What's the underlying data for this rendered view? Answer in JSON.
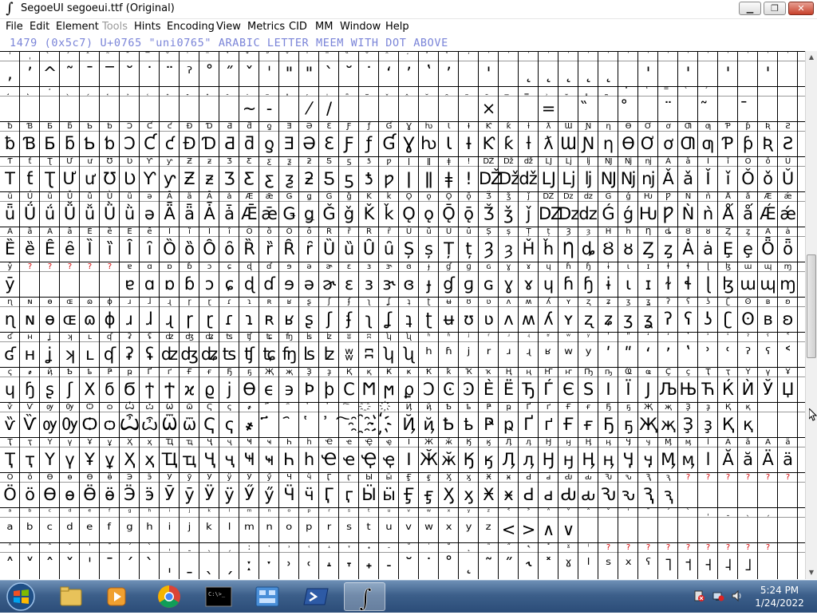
{
  "window": {
    "title": "SegoeUI  segoeui.ttf (Original)",
    "app_icon_glyph": "∫",
    "minimize_glyph": "▁",
    "maximize_glyph": "❐",
    "close_glyph": "✕"
  },
  "menu": [
    {
      "label": "File",
      "disabled": false
    },
    {
      "label": "Edit",
      "disabled": false
    },
    {
      "label": "Element",
      "disabled": false
    },
    {
      "label": "Tools",
      "disabled": true
    },
    {
      "label": "Hints",
      "disabled": false
    },
    {
      "label": "Encoding",
      "disabled": false
    },
    {
      "label": "View",
      "disabled": false
    },
    {
      "label": "Metrics",
      "disabled": false
    },
    {
      "label": "CID",
      "disabled": false
    },
    {
      "label": "MM",
      "disabled": false
    },
    {
      "label": "Window",
      "disabled": false
    },
    {
      "label": "Help",
      "disabled": false
    }
  ],
  "info_line": "1479 (0x5c7) U+0765 \"uni0765\" ARABIC LETTER MEEM WITH DOT ABOVE",
  "grid_rows": [
    {
      "labels": "ˈˌ̀́̂̃̄̅̆̇̈̉̊̋̌̍̎̏̐̑̒̓̔̕̚̚̚̚̚̚̚̚̚̚̚̚̚̚̚̚̚̚̚̚",
      "glyphs": ",ʼ^˜¯‾˘˙¨ˀ˚˝ˇˈ\"\"ˋ˘˙ʻʼʽʼ ' ˛˛˛˛˛ ' ' ' ' ' ' ' ' ' ' ' ' "
    },
    {
      "labels": "̧̨̛̖̗̘̙̜̝̞̟̠̣̤̥̦̩̪̫̬̭̮̯̰̱̲̳̹̺̻̼̽̾̿̀́",
      "glyphs": "            ~‐ ⁄/       ×  = ̏ ̊ ¨ ̃ ̄     ≈ ̃ "
    },
    {
      "labels": "ƀƁƂƃƄƅƆƇƈƉƊƋƌƍƎƏƐƑƒƓƔƕƖƗƘƙƚƛƜƝƞƟƠơƢƣƤƥƦƧƨƩƪƫ",
      "glyphs": "ƀƁƂƃƄƅƆƇƈƉƊƋƌƍƎƏƐƑƒƓƔƕƖƗƘƙƚƛƜƝƞƟƠơƢƣƤƥƦƧƨƩƪƫ"
    },
    {
      "labels": "ƬƭƮƯưƱƲƳƴƵƶƷƸƹƺƻƼƽƾƿǀǁǂǃǄǅǆǇǈǉǊǋǌǍǎǏǐǑǒǓǔǕ",
      "glyphs": "TƭƮƯưƱƲƳƴƵƶƷƸƹƺƻƼƽƾƿǀǁǂǃǄǅǆǇǈǉǊǋǌǍǎǏǐǑǒǓǔǕ"
    },
    {
      "labels": "ǖǗǘǙǚǛǜǝǞǟǠǡǢǣǤǥǦǧǨǩǪǫǬǭǮǯǰǱǲǳǴǵǶǷǸǹǺǻǼǽǾ",
      "glyphs": "ǖǗǘǙǚǛǜǝǞǟǠǡǢǣǤǥǦǧǨǩǪǫǬǭǮǯǰǱǲǳǴǵǶǷǸǹǺǻǼǽ"
    },
    {
      "labels": "ȀȁȂȃȄȅȆȇȈȉȊȋȌȍȎȏȐȑȒȓȔȕȖȗȘșȚțȜȝȞȟȠȡȢȣȤȥȦȧȨ",
      "glyphs": "ȄȅȆȇȈȉȊȋȌȍȎȏȐȑȒȓȔȕȖȗȘșȚțȜȝȞȟȠȡȢȣȤȥȦȧȨȩȪȫȬ"
    },
    {
      "labels": "ȳ?????ɐɑɒɓɔɕɖɗɘəɚɛɜɝɞɟɠɡɢɣɤɥɦɧɨɩɪɫɬɭɮɯɰɱɲ",
      "glyphs": "ȳ     ɐɑɒɓɔɕɖɗɘəɚɛɜɝɞɟɠɡɢɣɤɥɦɧɨɩɪɫɬɭɮɯɰɱɲ"
    },
    {
      "labels": "ɳɴɵɶɷɸɹɺɻɼɽɾɿʀʁʂʃʄʅʆʇʈʉʊʋʌʍʎʏʐʑʒʓʔʕʖʗʘʙʚ",
      "glyphs": "ɳɴɵɶɷɸɹɺɻɼɽɾɿʀʁʂʃʄʅʆʇʈʉʊʋʌʍʎʏʐʑʒʓʔʕʖʗʘʙʚ"
    },
    {
      "labels": "ʛʜʝʞʟʠʡʢʣʤʥʦʧʨʩʪʫʬʭʮʯʰʱʲʳʴʵʶʷʸʹʺʻʼʽʾʿˀˁ˂",
      "glyphs": "ʛʜʝʞʟʠʡʢʣʤʥʦʧʨʩʪʫʬʭʮʯʰʱʲʳʴʵʶʷʸʹʺʻʼʽʾʿˀˁ˂"
    },
    {
      "labels": "ҁ҂ҋҌҍҎҏҐґҒғҔҕҖҗҘҙҚқҜҝҞҟҠҡҢңҤҥҦҧҨҩҪҫҬҭҮүҰ",
      "glyphs": "ɥɧʂʃΧϭϬϯϮϰϱϳϴϵ϶ϷϸϹϺϻϼϽϾϿЀЁЂЃЄЅІЇЈЉЊЋЌЍЎЏ"
    },
    {
      "labels": "ѷѶѹѸѺѻѼѽѾѿҀҁ҂҃҄҅҆҇҈҉ҊҋҌҍҎҏҐґҒғҔҕҖҗҘҙҚқ",
      "glyphs": "ѷѶѹѸѺѻѼѽѾѿҀҁ҂҃҄҅҆҇҈҉ҊҋҌҍҎҏҐґҒғҔҕҖҗҘҙҚқ"
    },
    {
      "labels": "ҬҭҮүҰұҲҳҴҵҶҷҸҹҺһҼҽҾҿӀӁӂӃӄӅӆӇӈӉӊӋӌӍӎӏӐӑӒӓ",
      "glyphs": "ҬҭҮүҰұҲҳҴҵҶҷҸҹҺһҼҽҾҿӀӁӂӃӄӅӆӇӈӉӊӋӌӍӎӏӐӑӒӓ"
    },
    {
      "labels": "ӦӧӨөӪӫӬӭӮӯӰӱӲӳӴӵӶӷӸӹӺӻӼӽӾӿԀԁԂԃԄԅԆԇ??????ɛ",
      "glyphs": "ӦӧӨөӪӫӬӭӮӯӰӱӲӳӴӵӶӷӸӹӺӻӼӽӾӿԀԁԂԃԄԅԆԇ"
    },
    {
      "labels": "ᵃᵇᶜᵈᵉᶠᵍʰⁱʲᵏˡᵐⁿᵒᵖʳˢᵗᵘᵛʷˣʸᶻ˂˃˄˅ˆˇˈˉˊˋˌˍˎˏ",
      "glyphs": "ᵃᵇᶜᵈᵉᶠᵍʰⁱʲᵏˡᵐⁿᵒᵖʳˢᵗᵘᵛʷˣʸᶻ<>∧∨"
    },
    {
      "labels": "˄˅ˆˇˈˉˊˋˌˍˎˏːˑ˒˓˔˕˖˗˘˙˚˛˜˝˞˟ˠˡ?????????",
      "glyphs": "˄˅ˆˇˈˉˊˋˌˍˎˏːˑ˒˓˔˕˖˗˘˙˚˛˜˝˞˟ˠˡˢˣˤ˥˦˧˨˩"
    }
  ],
  "taskbar": {
    "apps": [
      {
        "name": "explorer"
      },
      {
        "name": "media-player"
      },
      {
        "name": "chrome"
      },
      {
        "name": "command-prompt"
      },
      {
        "name": "control-panel"
      },
      {
        "name": "powershell"
      },
      {
        "name": "fontforge",
        "active": true
      }
    ],
    "time": "5:24 PM",
    "date": "1/24/2022"
  }
}
